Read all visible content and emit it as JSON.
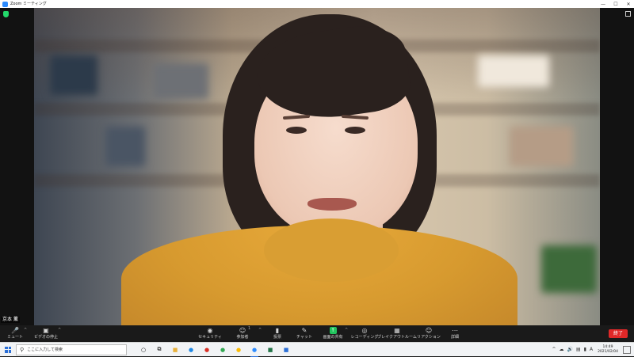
{
  "window": {
    "title": "Zoom ミーティング",
    "controls": [
      "minimize",
      "maximize",
      "close"
    ]
  },
  "meeting": {
    "participant_name": "京本 薫"
  },
  "toolbar": {
    "mute_label": "ミュート",
    "video_label": "ビデオの停止",
    "security_label": "セキュリティ",
    "participants_label": "参加者",
    "participants_count": "1",
    "polls_label": "投票",
    "chat_label": "チャット",
    "share_label": "画面の共有",
    "record_label": "レコーディング",
    "breakout_label": "ブレイクアウトルーム",
    "reactions_label": "リアクション",
    "more_label": "詳細",
    "end_label": "終了"
  },
  "taskbar": {
    "search_placeholder": "ここに入力して検索",
    "apps": [
      "task-view",
      "file-explorer",
      "edge",
      "chrome",
      "chrome",
      "chrome",
      "zoom",
      "excel",
      "windows-security"
    ],
    "tray_lang": "A",
    "time": "14:49",
    "date": "2021/02/04"
  },
  "colors": {
    "zoom_blue": "#2D8CFF",
    "end_red": "#E02828",
    "share_green": "#22C55E",
    "sweater": "#D99E33"
  }
}
